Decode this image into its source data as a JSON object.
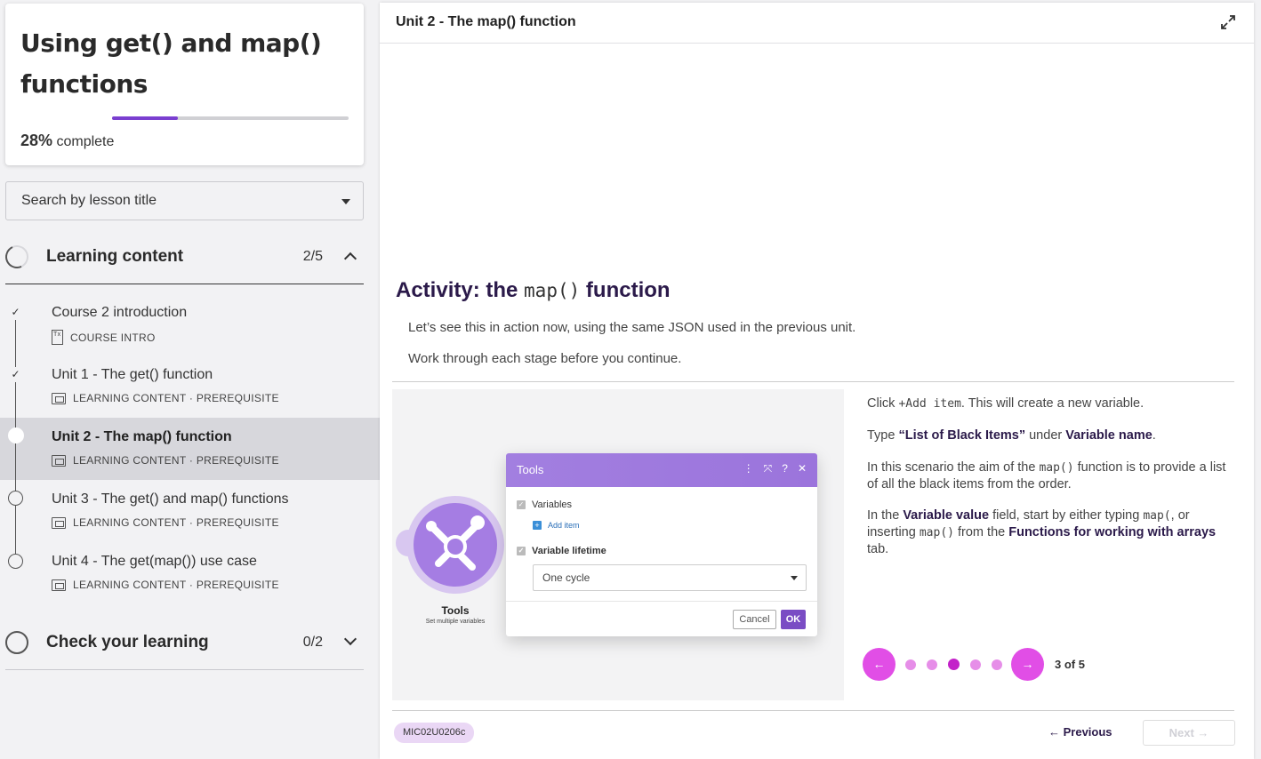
{
  "course": {
    "title": "Using get() and map() functions",
    "progress_percent": 28,
    "progress_value": "28%",
    "progress_suffix": " complete"
  },
  "search": {
    "label": "Search by lesson title"
  },
  "sections": [
    {
      "title": "Learning content",
      "count": "2/5",
      "expanded": true
    },
    {
      "title": "Check your learning",
      "count": "0/2",
      "expanded": false
    }
  ],
  "lessons": [
    {
      "title": "Course 2 introduction",
      "meta": "COURSE INTRO",
      "status": "complete",
      "icon": "document-icon"
    },
    {
      "title": "Unit 1 - The get() function",
      "meta": "LEARNING CONTENT · PREREQUISITE",
      "status": "complete",
      "icon": "slides-icon"
    },
    {
      "title": "Unit 2 - The map() function",
      "meta": "LEARNING CONTENT · PREREQUISITE",
      "status": "current",
      "icon": "slides-icon"
    },
    {
      "title": "Unit 3 - The get() and map() functions",
      "meta": "LEARNING CONTENT · PREREQUISITE",
      "status": "not-started",
      "icon": "slides-icon"
    },
    {
      "title": "Unit 4 - The get(map()) use case",
      "meta": "LEARNING CONTENT · PREREQUISITE",
      "status": "not-started",
      "icon": "slides-icon"
    }
  ],
  "main": {
    "header_title": "Unit 2 - The map() function",
    "activity_title_prefix": "Activity: the ",
    "activity_title_code": "map()",
    "activity_title_suffix": " function",
    "intro_1": "Let’s see this in action now, using the same JSON used in the previous unit.",
    "intro_2": "Work through each stage before you continue."
  },
  "figure": {
    "tools_label": "Tools",
    "tools_sub": "Set multiple variables",
    "dialog_title": "Tools",
    "variables_label": "Variables",
    "add_item_label": "Add item",
    "lifetime_label": "Variable lifetime",
    "lifetime_value": "One cycle",
    "cancel_label": "Cancel",
    "ok_label": "OK"
  },
  "steps": {
    "p1_a": "Click ",
    "p1_code": "+Add item",
    "p1_b": ". This will create a new variable.",
    "p2_a": "Type ",
    "p2_b1": "“List of Black Items”",
    "p2_c": " under ",
    "p2_b2": "Variable name",
    "p2_d": ".",
    "p3_a": "In this scenario the aim of the ",
    "p3_code": "map()",
    "p3_b": " function is to provide a list of all the black items from the order.",
    "p4_a": "In the ",
    "p4_b1": "Variable value",
    "p4_c": " field, start by either typing ",
    "p4_code1": "map(",
    "p4_d": ", or inserting ",
    "p4_code2": "map()",
    "p4_e": " from the ",
    "p4_b2": "Functions for working with arrays",
    "p4_f": " tab."
  },
  "carousel": {
    "current": 3,
    "total": 5,
    "label": "3 of 5",
    "prev_icon": "arrow-left-icon",
    "next_icon": "arrow-right-icon"
  },
  "footer": {
    "code": "MIC02U0206c",
    "previous_label": "← Previous",
    "next_label": "Next →"
  },
  "colors": {
    "accent": "#e14ee6",
    "purple": "#7a4cc4",
    "dark": "#2b1a4a"
  }
}
